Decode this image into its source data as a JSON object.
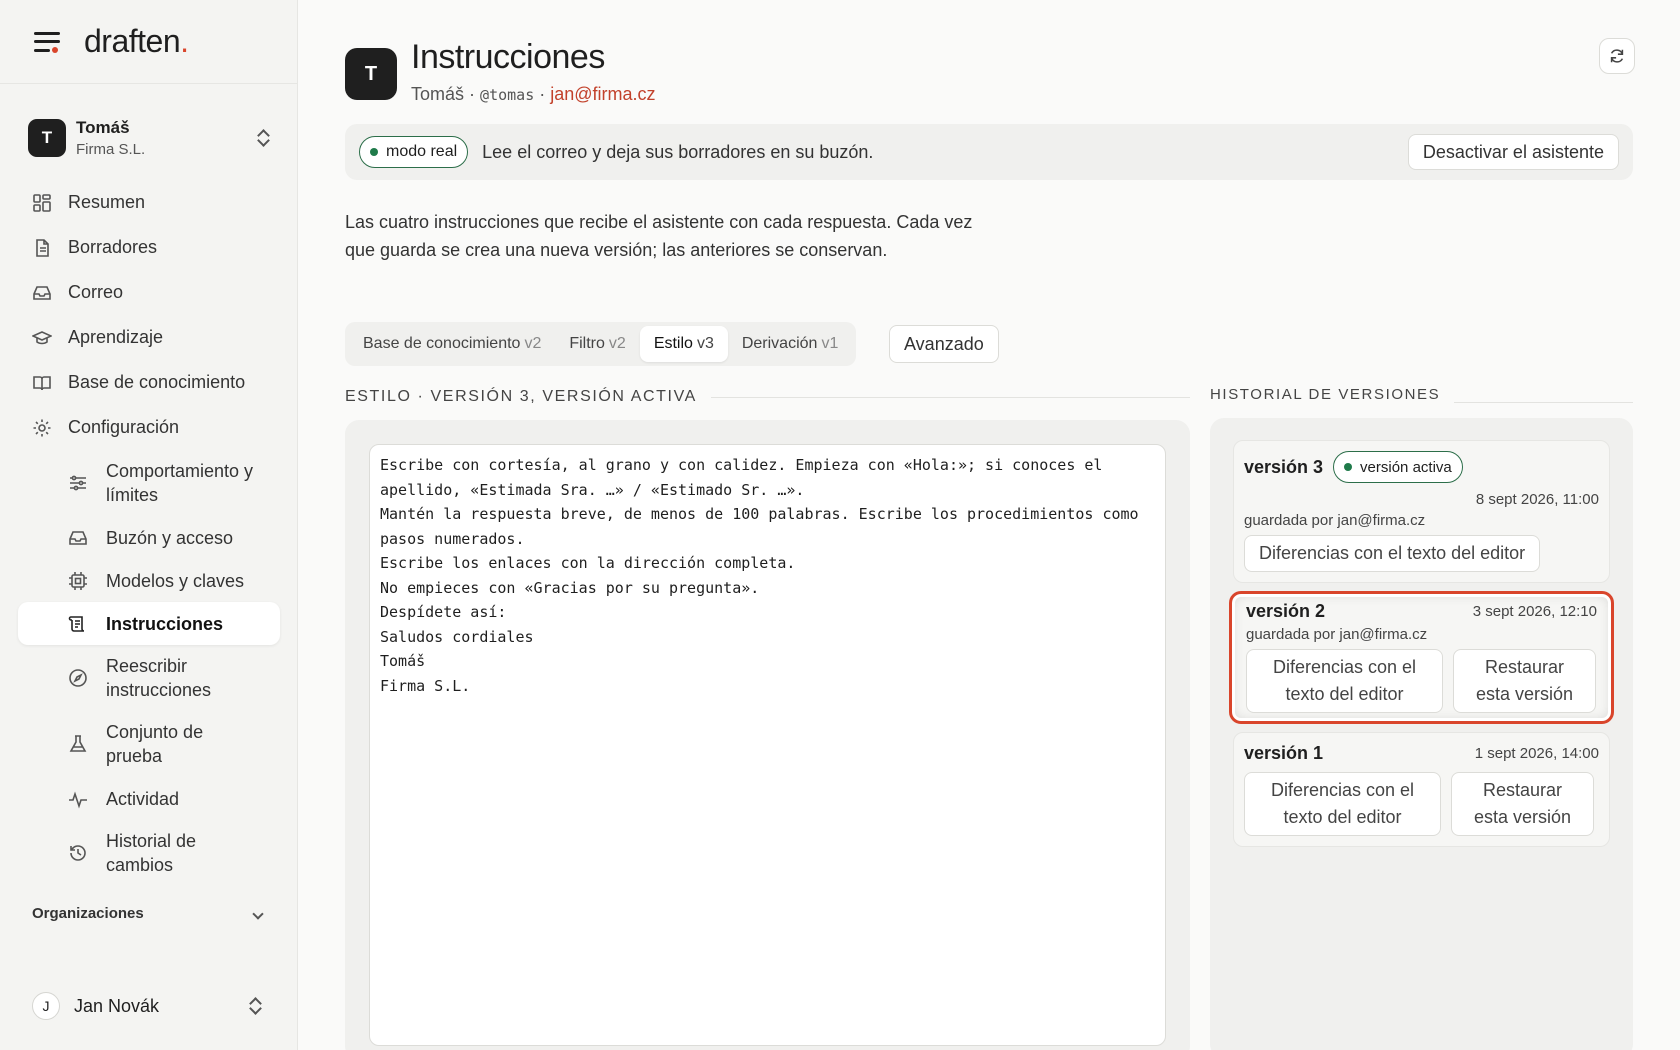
{
  "brand": {
    "name": "draften",
    "dot": "."
  },
  "account": {
    "initial": "T",
    "name": "Tomáš",
    "org": "Firma S.L."
  },
  "nav": {
    "items": [
      {
        "label": "Resumen",
        "icon": "dashboard-icon"
      },
      {
        "label": "Borradores",
        "icon": "document-icon"
      },
      {
        "label": "Correo",
        "icon": "inbox-icon"
      },
      {
        "label": "Aprendizaje",
        "icon": "graduation-cap-icon"
      },
      {
        "label": "Base de conocimiento",
        "icon": "book-icon"
      },
      {
        "label": "Configuración",
        "icon": "gear-icon"
      }
    ],
    "sub": [
      {
        "label": "Comportamiento y límites",
        "icon": "sliders-icon"
      },
      {
        "label": "Buzón y acceso",
        "icon": "inbox-icon"
      },
      {
        "label": "Modelos y claves",
        "icon": "chip-icon"
      },
      {
        "label": "Instrucciones",
        "icon": "scroll-icon"
      },
      {
        "label": "Reescribir instrucciones",
        "icon": "compass-icon"
      },
      {
        "label": "Conjunto de prueba",
        "icon": "flask-icon"
      },
      {
        "label": "Actividad",
        "icon": "activity-icon"
      },
      {
        "label": "Historial de cambios",
        "icon": "history-icon"
      }
    ],
    "orgs_label": "Organizaciones"
  },
  "user": {
    "initial": "J",
    "name": "Jan Novák"
  },
  "page": {
    "initial": "T",
    "title": "Instrucciones",
    "sub_name": "Tomáš",
    "sep": "·",
    "handle": "@tomas",
    "email": "jan@firma.cz"
  },
  "banner": {
    "pill": "modo real",
    "text": "Lee el correo y deja sus borradores en su buzón.",
    "button": "Desactivar el asistente"
  },
  "description": "Las cuatro instrucciones que recibe el asistente con cada respuesta. Cada vez que guarda se crea una nueva versión; las anteriores se conservan.",
  "tabs": [
    {
      "label": "Base de conocimiento",
      "ver": "v2"
    },
    {
      "label": "Filtro",
      "ver": "v2"
    },
    {
      "label": "Estilo",
      "ver": "v3"
    },
    {
      "label": "Derivación",
      "ver": "v1"
    }
  ],
  "advanced_button": "Avanzado",
  "section_label": "ESTILO · VERSIÓN 3, VERSIÓN ACTIVA",
  "editor_text": "Escribe con cortesía, al grano y con calidez. Empieza con «Hola:»; si conoces el apellido, «Estimada Sra. …» / «Estimado Sr. …».\nMantén la respuesta breve, de menos de 100 palabras. Escribe los procedimientos como pasos numerados.\nEscribe los enlaces con la dirección completa.\nNo empieces con «Gracias por su pregunta».\nDespídete así:\nSaludos cordiales\nTomáš\nFirma S.L.",
  "history": {
    "label": "HISTORIAL DE VERSIONES",
    "versions": [
      {
        "title": "versión 3",
        "badge": "versión activa",
        "date": "8 sept 2026, 11:00",
        "by": "guardada por jan@firma.cz",
        "diff": "Diferencias con el texto del editor"
      },
      {
        "title": "versión 2",
        "date": "3 sept 2026, 12:10",
        "by": "guardada por jan@firma.cz",
        "diff": "Diferencias con el texto del editor",
        "restore": "Restaurar esta versión"
      },
      {
        "title": "versión 1",
        "date": "1 sept 2026, 14:00",
        "diff": "Diferencias con el texto del editor",
        "restore": "Restaurar esta versión"
      }
    ]
  },
  "colors": {
    "accent": "#d9452b",
    "live": "#1f7a4a",
    "email": "#c2412b"
  }
}
